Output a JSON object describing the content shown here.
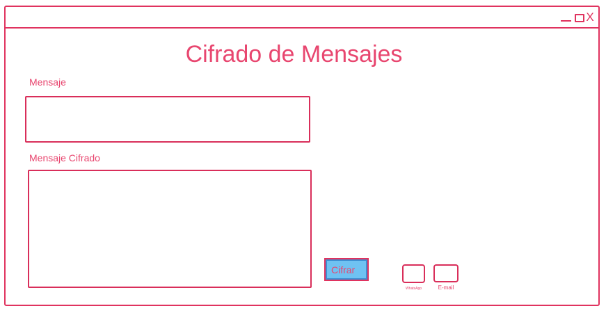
{
  "window": {
    "controls": {
      "minimize_icon": "minimize-icon",
      "maximize_icon": "maximize-icon",
      "close_label": "X"
    }
  },
  "app": {
    "title": "Cifrado de Mensajes"
  },
  "form": {
    "message_label": "Mensaje",
    "message_value": "",
    "cipher_label": "Mensaje Cifrado",
    "cipher_value": "",
    "encrypt_button": "Cifrar"
  },
  "share": {
    "whatsapp_label": "WhatsApp",
    "email_label": "E-mail"
  },
  "colors": {
    "accent": "#e0335f",
    "button_fill": "#6fc2f2",
    "button_inner_border": "#3d8fd1"
  }
}
